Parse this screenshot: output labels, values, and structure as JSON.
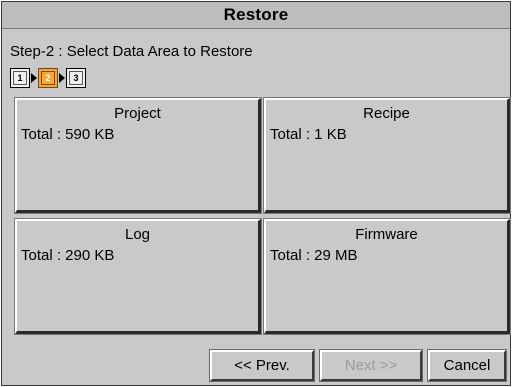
{
  "window": {
    "title": "Restore"
  },
  "step": {
    "label": "Step-2 : Select Data Area to Restore",
    "steps": [
      "1",
      "2",
      "3"
    ],
    "current": 2
  },
  "areas": [
    {
      "name": "Project",
      "total": "Total : 590 KB"
    },
    {
      "name": "Recipe",
      "total": "Total : 1 KB"
    },
    {
      "name": "Log",
      "total": "Total : 290 KB"
    },
    {
      "name": "Firmware",
      "total": "Total : 29 MB"
    }
  ],
  "buttons": {
    "prev": "<< Prev.",
    "next": "Next >>",
    "cancel": "Cancel"
  },
  "colors": {
    "active_step": "#f7a43b",
    "background": "#c9c9c9"
  }
}
